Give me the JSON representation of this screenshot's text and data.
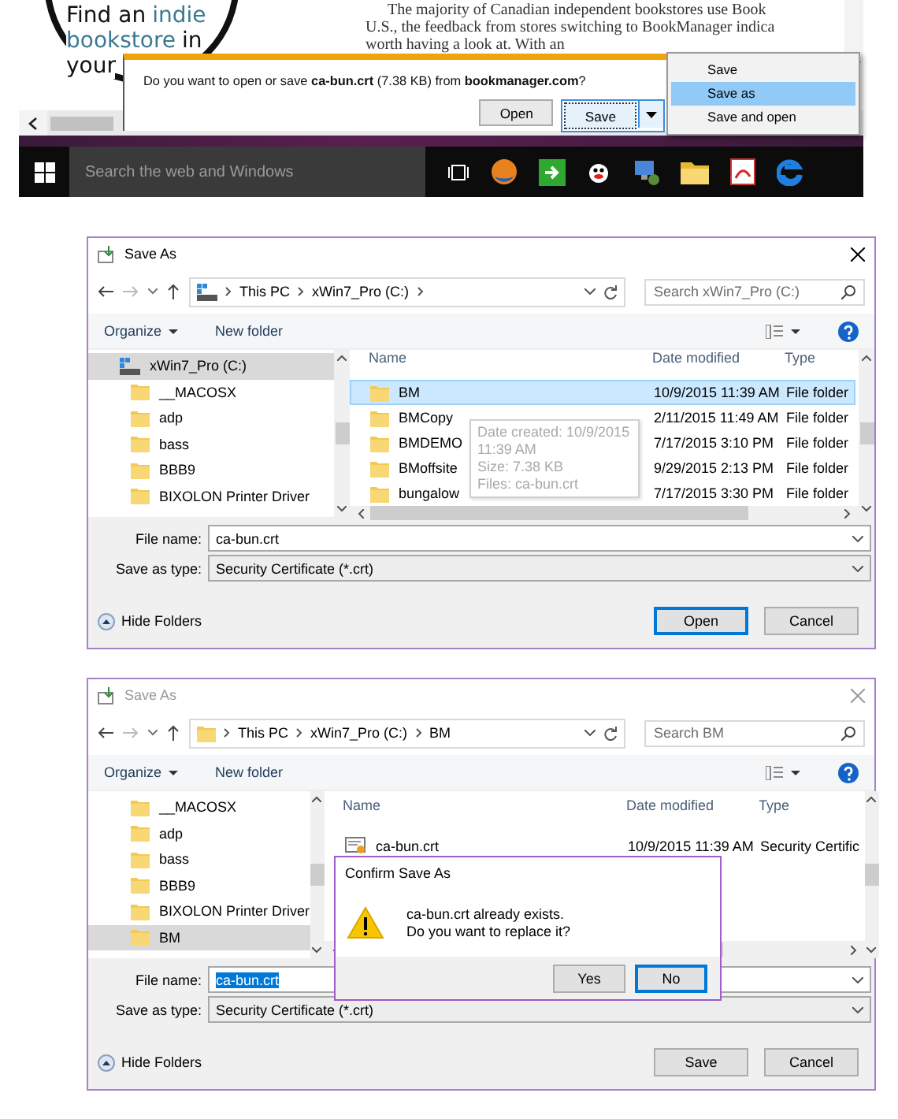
{
  "browser": {
    "logo_lines": [
      [
        {
          "text": "Find an",
          "accent": false
        },
        {
          "text": "indie",
          "accent": true
        }
      ],
      [
        {
          "text": "bookstore",
          "accent": true
        },
        {
          "text": "in",
          "accent": false
        }
      ],
      [
        {
          "text": "your",
          "accent": false
        }
      ]
    ],
    "article_lines": [
      "The majority of Canadian independent bookstores use Book",
      "U.S., the feedback from stores switching to BookManager indica",
      "worth having a look at. With an"
    ],
    "download_bar": {
      "message": "Do you want to open or save **ca-bun.crt** (7.38 KB) from **bookmanager.com**?",
      "buttons": [
        {
          "label": "Open",
          "kind": "plain"
        },
        {
          "label": "Save",
          "kind": "split"
        }
      ]
    },
    "save_menu": [
      {
        "label": "Save",
        "selected": false
      },
      {
        "label": "Save as",
        "selected": true
      },
      {
        "label": "Save and open",
        "selected": false
      }
    ],
    "taskbar": {
      "search_placeholder": "Search the web and Windows"
    }
  },
  "dialogs": [
    {
      "title": "Save As",
      "active": true,
      "address": {
        "kind": "drive",
        "path": [
          "This PC",
          "xWin7_Pro (C:)"
        ]
      },
      "search_placeholder": "Search xWin7_Pro (C:)",
      "toolbar": [
        "Organize",
        "New folder"
      ],
      "columns": [
        "Name",
        "Date modified",
        "Type"
      ],
      "sidebar": [
        {
          "label": "xWin7_Pro (C:)",
          "kind": "drive",
          "selected": true,
          "children": [
            {
              "label": "__MACOSX",
              "kind": "folder",
              "selected": false
            },
            {
              "label": "adp",
              "kind": "folder",
              "selected": false
            },
            {
              "label": "bass",
              "kind": "folder",
              "selected": false
            },
            {
              "label": "BBB9",
              "kind": "folder",
              "selected": false
            },
            {
              "label": "BIXOLON Printer Driver",
              "kind": "folder",
              "selected": false
            }
          ]
        }
      ],
      "files": [
        {
          "name": "BM",
          "kind": "folder",
          "date": "10/9/2015 11:39 AM",
          "type": "File folder",
          "selected": true
        },
        {
          "name": "BMCopy",
          "kind": "folder",
          "date": "2/11/2015 11:49 AM",
          "type": "File folder",
          "selected": false
        },
        {
          "name": "BMDEMO",
          "kind": "folder",
          "date": "7/17/2015 3:10 PM",
          "type": "File folder",
          "selected": false
        },
        {
          "name": "BMoffsite",
          "kind": "folder",
          "date": "9/29/2015 2:13 PM",
          "type": "File folder",
          "selected": false
        },
        {
          "name": "bungalow",
          "kind": "folder",
          "date": "7/17/2015 3:30 PM",
          "type": "File folder",
          "selected": false
        }
      ],
      "tooltip": {
        "lines": [
          "Date created: 10/9/2015 11:39 AM",
          "Size: 7.38 KB",
          "Files: ca-bun.crt"
        ]
      },
      "file_name": {
        "label": "File name:",
        "value": "ca-bun.crt",
        "highlighted": false
      },
      "save_type": {
        "label": "Save as type:",
        "value": "Security Certificate (*.crt)"
      },
      "hide_folders": "Hide Folders",
      "buttons": [
        {
          "label": "Open",
          "default": true
        },
        {
          "label": "Cancel",
          "default": false
        }
      ]
    },
    {
      "title": "Save As",
      "active": false,
      "address": {
        "kind": "folder",
        "path": [
          "This PC",
          "xWin7_Pro (C:)",
          "BM"
        ]
      },
      "search_placeholder": "Search BM",
      "toolbar": [
        "Organize",
        "New folder"
      ],
      "columns": [
        "Name",
        "Date modified",
        "Type"
      ],
      "sidebar": [
        {
          "label": "__MACOSX",
          "kind": "folder",
          "selected": false
        },
        {
          "label": "adp",
          "kind": "folder",
          "selected": false
        },
        {
          "label": "bass",
          "kind": "folder",
          "selected": false
        },
        {
          "label": "BBB9",
          "kind": "folder",
          "selected": false
        },
        {
          "label": "BIXOLON Printer Driver",
          "kind": "folder",
          "selected": false
        },
        {
          "label": "BM",
          "kind": "folder",
          "selected": true
        }
      ],
      "files": [
        {
          "name": "ca-bun.crt",
          "kind": "cert",
          "date": "10/9/2015 11:39 AM",
          "type": "Security Certific",
          "selected": false
        }
      ],
      "file_name": {
        "label": "File name:",
        "value": "ca-bun.crt",
        "highlighted": true
      },
      "save_type": {
        "label": "Save as type:",
        "value": "Security Certificate (*.crt)"
      },
      "hide_folders": "Hide Folders",
      "buttons": [
        {
          "label": "Save",
          "default": false
        },
        {
          "label": "Cancel",
          "default": false
        }
      ],
      "confirm": {
        "title": "Confirm Save As",
        "lines": [
          "ca-bun.crt already exists.",
          "Do you want to replace it?"
        ],
        "buttons": [
          {
            "label": "Yes",
            "default": false
          },
          {
            "label": "No",
            "default": true
          }
        ]
      }
    }
  ]
}
